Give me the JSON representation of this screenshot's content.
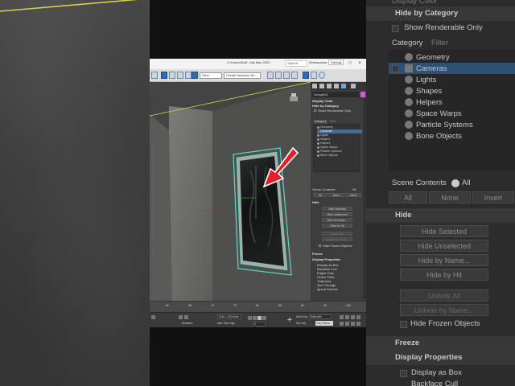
{
  "window": {
    "title": "C:\\Users\\Staff - 3ds Max 2023",
    "search_label": "Style M",
    "workspace_label": "Workspaces:",
    "workspace_value": "Default",
    "minimize": "–",
    "maximize": "□",
    "close": "×"
  },
  "toolbar": {
    "view_dropdown": "View",
    "selection_dropdown": "Create Selection Se..."
  },
  "command_panel": {
    "object_name": "Group001",
    "object_color": "#d25ad2",
    "display_color": "Display Color",
    "hide_by_category": "Hide by Category",
    "show_renderable_only": "Show Renderable Only",
    "tab_category": "Category",
    "tab_filter": "Filter",
    "categories": [
      "Geometry",
      "Cameras",
      "Lights",
      "Shapes",
      "Helpers",
      "Space Warps",
      "Particle Systems",
      "Bone Objects"
    ],
    "selected_category": "Cameras",
    "scene_contents": "Scene Contents",
    "scene_all": "All",
    "btn_all": "All",
    "btn_none": "None",
    "btn_invert": "Invert",
    "hide_section": "Hide",
    "hide_selected": "Hide Selected",
    "hide_unselected": "Hide Unselected",
    "hide_by_name": "Hide by Name...",
    "hide_by_hit": "Hide by Hit",
    "unhide_all": "Unhide All",
    "unhide_by_name": "Unhide by Name...",
    "hide_frozen": "Hide Frozen Objects",
    "freeze_section": "Freeze",
    "display_properties": "Display Properties",
    "props": [
      "Display as Box",
      "Backface Cull",
      "Edges Only",
      "Vertex Ticks",
      "Trajectory",
      "See-Through",
      "Ignore Extents"
    ]
  },
  "timeline": {
    "ticks": [
      "60",
      "65",
      "70",
      "75",
      "80",
      "85",
      "90",
      "95",
      "100"
    ]
  },
  "statusbar": {
    "enabled": "Enabled:",
    "grid": "Grid = 100.0mm",
    "add_time_tag": "Add Time Tag",
    "auto_key": "Auto Key",
    "set_key": "Set Key",
    "selected": "Selected",
    "key_filters": "Key Filters...",
    "frame": "0"
  },
  "zoom_panel": {
    "display_color": "Display Color",
    "hide_by_category": "Hide by Category",
    "show_renderable_only": "Show Renderable Only",
    "tab_category": "Category",
    "tab_filter": "Filter",
    "categories": [
      "Geometry",
      "Cameras",
      "Lights",
      "Shapes",
      "Helpers",
      "Space Warps",
      "Particle Systems",
      "Bone Objects"
    ],
    "scene_contents": "Scene Contents",
    "scene_all": "All",
    "btn_all": "All",
    "btn_none": "None",
    "btn_invert": "Invert",
    "hide_section": "Hide",
    "hide_selected": "Hide Selected",
    "hide_unselected": "Hide Unselected",
    "hide_by_name": "Hide by Name...",
    "hide_by_hit": "Hide by Hit",
    "unhide_all": "Unhide All",
    "unhide_by_name": "Unhide by Name...",
    "hide_frozen": "Hide Frozen Objects",
    "freeze_section": "Freeze",
    "display_properties": "Display Properties",
    "display_as_box": "Display as Box",
    "backface_cull": "Backface Cull"
  },
  "colors": {
    "accent_blue": "#3b6ea5",
    "arrow_red": "#e0202a",
    "frame_teal": "#5fd8c8"
  }
}
